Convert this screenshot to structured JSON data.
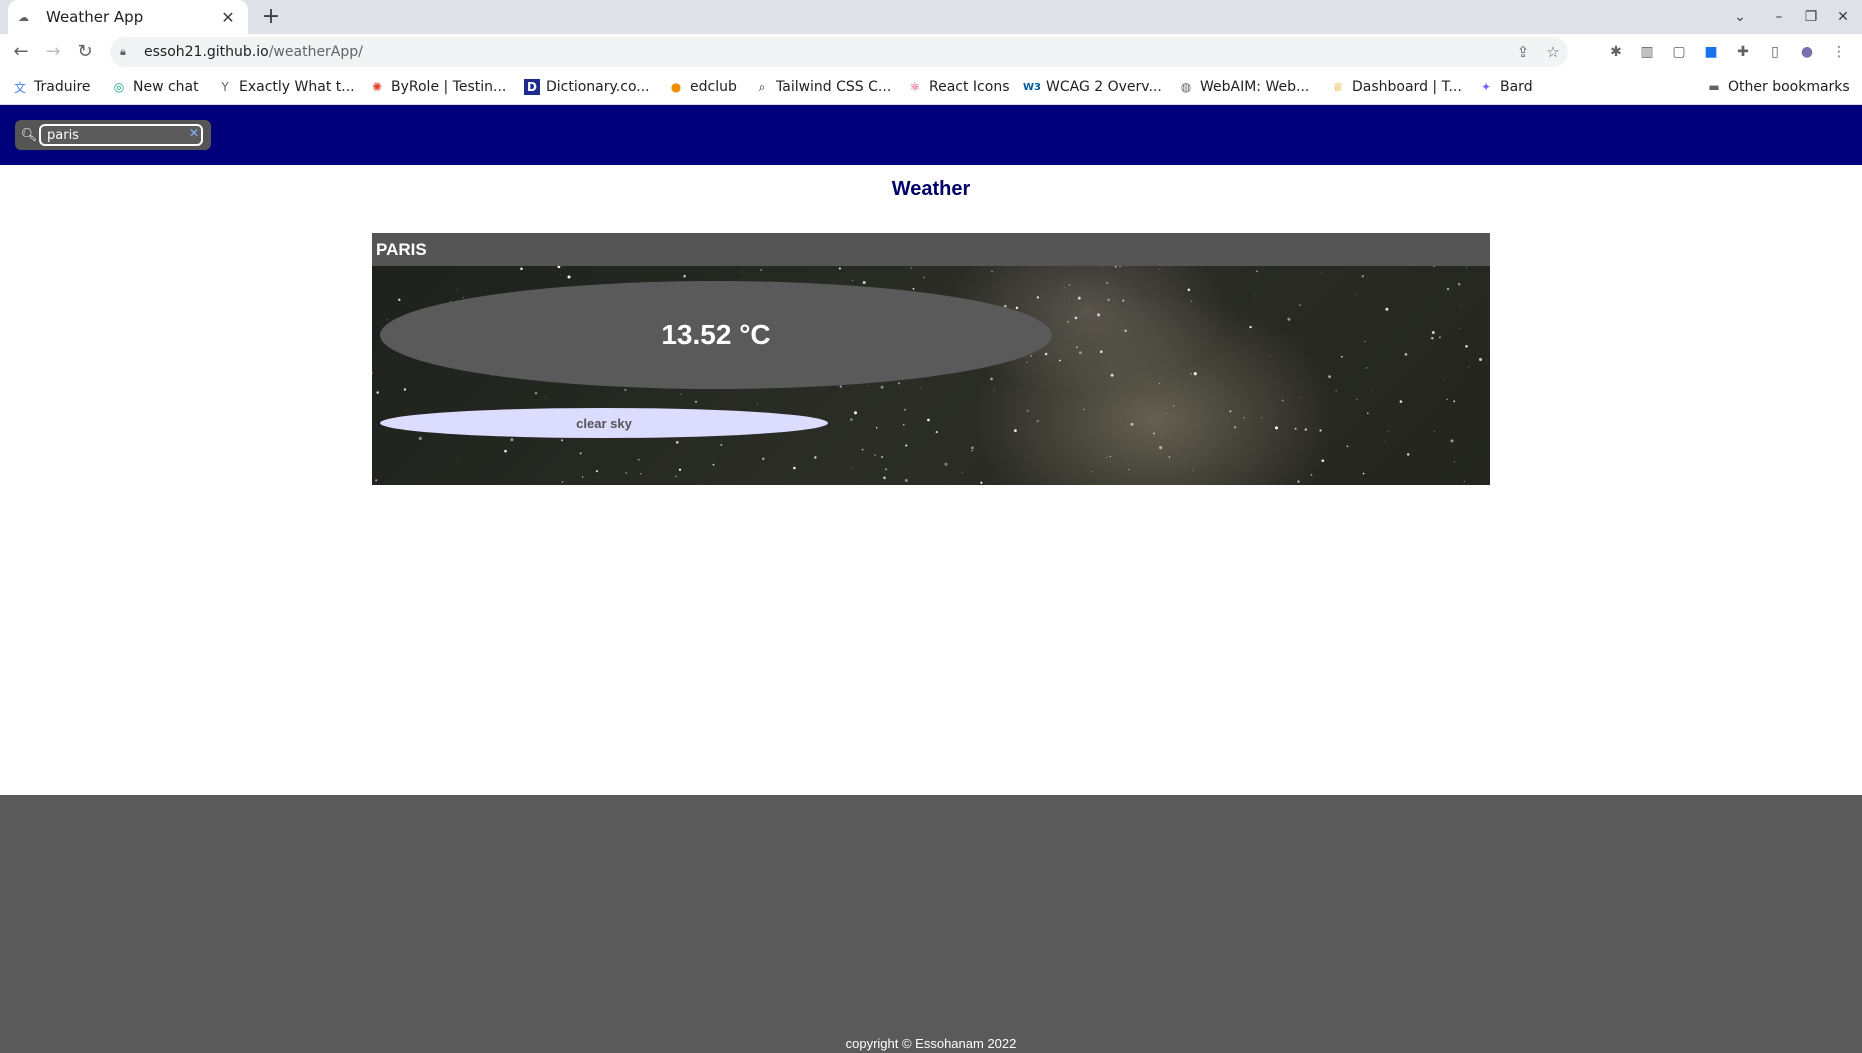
{
  "browser": {
    "tab_title": "Weather App",
    "new_tab_symbol": "+",
    "url_host": "essoh21.github.io",
    "url_path": "/weatherApp/"
  },
  "bookmarks": [
    {
      "label": "Traduire",
      "icon": "translate-icon"
    },
    {
      "label": "New chat",
      "icon": "chat-icon"
    },
    {
      "label": "Exactly What t...",
      "icon": "y-icon"
    },
    {
      "label": "ByRole | Testin...",
      "icon": "octopus-icon"
    },
    {
      "label": "Dictionary.co...",
      "icon": "dictionary-icon"
    },
    {
      "label": "edclub",
      "icon": "edclub-icon"
    },
    {
      "label": "Tailwind CSS C...",
      "icon": "search-icon"
    },
    {
      "label": "React Icons",
      "icon": "react-icon"
    },
    {
      "label": "WCAG 2 Overv...",
      "icon": "w3c-icon"
    },
    {
      "label": "WebAIM: Web...",
      "icon": "globe-icon"
    },
    {
      "label": "Dashboard | T...",
      "icon": "trophy-icon"
    },
    {
      "label": "Bard",
      "icon": "sparkle-icon"
    }
  ],
  "other_bookmarks": "Other bookmarks",
  "search": {
    "value": "paris"
  },
  "page": {
    "title": "Weather"
  },
  "weather": {
    "city": "PARIS",
    "temperature": "13.52 °C",
    "description": "clear sky"
  },
  "footer": {
    "copyright": "copyright © Essohanam 2022"
  },
  "colors": {
    "navbar": "#00007a",
    "title": "#000066",
    "card_header": "#555555",
    "temp_oval": "#5a5a5a",
    "desc_oval": "#dcdcff",
    "footer": "#5a5a5a"
  }
}
